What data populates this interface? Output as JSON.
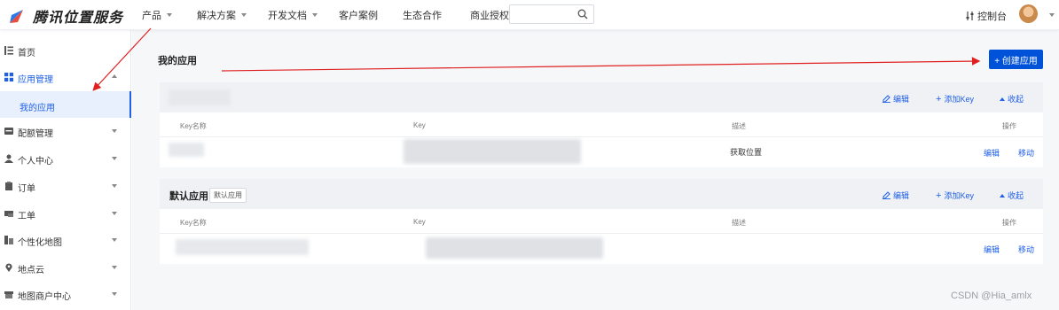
{
  "topbar": {
    "logo_text": "腾讯位置服务",
    "nav": [
      {
        "label": "产品",
        "has_caret": true
      },
      {
        "label": "解决方案",
        "has_caret": true
      },
      {
        "label": "开发文档",
        "has_caret": true
      },
      {
        "label": "客户案例",
        "has_caret": false
      },
      {
        "label": "生态合作",
        "has_caret": false
      },
      {
        "label": "商业授权",
        "has_caret": false
      }
    ],
    "search": {
      "value": "",
      "placeholder": ""
    },
    "console_label": "控制台"
  },
  "sidebar": {
    "items": [
      {
        "label": "首页",
        "icon": "list-icon"
      },
      {
        "label": "应用管理",
        "icon": "grid-icon"
      },
      {
        "label": "配额管理",
        "icon": "card-icon"
      },
      {
        "label": "个人中心",
        "icon": "person-icon"
      },
      {
        "label": "订单",
        "icon": "clipboard-icon"
      },
      {
        "label": "工单",
        "icon": "ticket-icon"
      },
      {
        "label": "个性化地图",
        "icon": "map-style-icon"
      },
      {
        "label": "地点云",
        "icon": "location-pin-icon"
      },
      {
        "label": "地图商户中心",
        "icon": "store-icon"
      }
    ],
    "sub_active": "我的应用"
  },
  "main": {
    "title": "我的应用",
    "create_button": "+ 创建应用",
    "cards": [
      {
        "title": "",
        "tag": "",
        "actions": {
          "edit": "编辑",
          "add_key": "添加Key",
          "collapse": "收起"
        },
        "columns": {
          "key_name": "Key名称",
          "key": "Key",
          "desc": "描述",
          "ops": "操作"
        },
        "row": {
          "desc": "获取位置",
          "edit": "编辑",
          "move": "移动"
        }
      },
      {
        "title": "默认应用",
        "tag": "默认应用",
        "actions": {
          "edit": "编辑",
          "add_key": "添加Key",
          "collapse": "收起"
        },
        "columns": {
          "key_name": "Key名称",
          "key": "Key",
          "desc": "描述",
          "ops": "操作"
        },
        "row": {
          "desc": "",
          "edit": "编辑",
          "move": "移动"
        }
      }
    ]
  },
  "watermark": "CSDN @Hia_amlx",
  "colors": {
    "accent": "#0052d9",
    "link": "#2060e8",
    "annotation": "#e02020"
  }
}
